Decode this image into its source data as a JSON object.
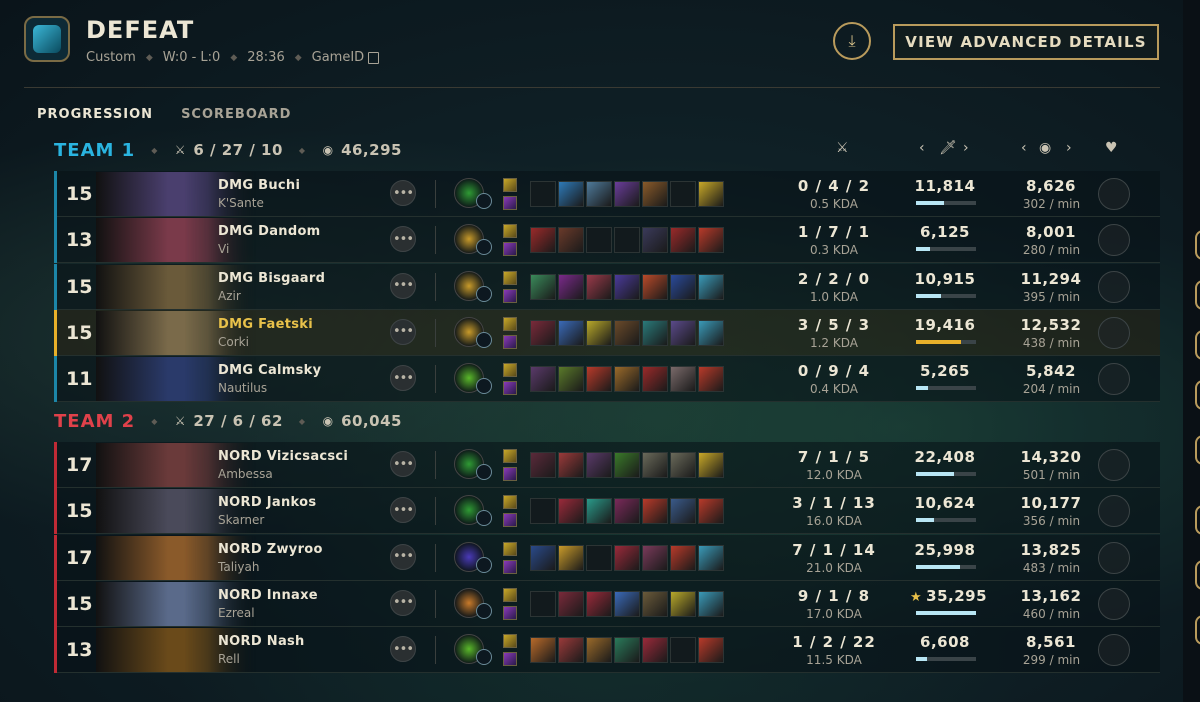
{
  "header": {
    "title": "DEFEAT",
    "mode": "Custom",
    "record": "W:0 - L:0",
    "duration": "28:36",
    "game_id_label": "GameID",
    "advanced_button": "VIEW ADVANCED DETAILS"
  },
  "tabs": [
    "PROGRESSION",
    "SCOREBOARD"
  ],
  "teams": [
    {
      "name": "TEAM 1",
      "kda": "6 / 27 / 10",
      "gold": "46,295",
      "color": "#2ab4e0",
      "players": [
        {
          "level": "15",
          "name": "DMG Buchi",
          "champion": "K'Sante",
          "kda": "0 / 4 / 2",
          "kda_ratio": "0.5 KDA",
          "damage": "11,814",
          "damage_fraction": 0.46,
          "gold": "8,626",
          "gpm": "302 / min",
          "portrait_color": "#4a3f6e",
          "rune_color": "#2f9a34",
          "items": [
            "",
            "#2e7ab8",
            "#4e7a9a",
            "#6a3d9a",
            "#8a5a2a",
            "",
            "#c8a828"
          ]
        },
        {
          "level": "13",
          "name": "DMG Dandom",
          "champion": "Vi",
          "kda": "1 / 7 / 1",
          "kda_ratio": "0.3 KDA",
          "damage": "6,125",
          "damage_fraction": 0.24,
          "gold": "8,001",
          "gpm": "280 / min",
          "portrait_color": "#7a3a4a",
          "rune_color": "#c89a2a",
          "items": [
            "#9a2a2a",
            "#6a3a2a",
            "",
            "",
            "#3a3a5a",
            "#9a2a2a",
            "#b83a2a"
          ]
        },
        {
          "level": "15",
          "name": "DMG Bisgaard",
          "champion": "Azir",
          "kda": "2 / 2 / 0",
          "kda_ratio": "1.0 KDA",
          "damage": "10,915",
          "damage_fraction": 0.42,
          "gold": "11,294",
          "gpm": "395 / min",
          "portrait_color": "#6a5a3a",
          "rune_color": "#c89a2a",
          "items": [
            "#3a8a5a",
            "#7a2a8a",
            "#9a3a4a",
            "#4a3a9a",
            "#b84a2a",
            "#2a4a9a",
            "#3a9ab8"
          ]
        },
        {
          "level": "15",
          "name": "DMG Faetski",
          "champion": "Corki",
          "kda": "3 / 5 / 3",
          "kda_ratio": "1.2 KDA",
          "damage": "19,416",
          "damage_fraction": 0.75,
          "gold": "12,532",
          "gpm": "438 / min",
          "portrait_color": "#7a6a4a",
          "rune_color": "#c89a2a",
          "items": [
            "#7a2a3a",
            "#3a6ab8",
            "#b8a82a",
            "#6a4a2a",
            "#2a7a7a",
            "#5a4a8a",
            "#3a9ab8"
          ]
        },
        {
          "level": "11",
          "name": "DMG Calmsky",
          "champion": "Nautilus",
          "kda": "0 / 9 / 4",
          "kda_ratio": "0.4 KDA",
          "damage": "5,265",
          "damage_fraction": 0.2,
          "gold": "5,842",
          "gpm": "204 / min",
          "portrait_color": "#2a3a6a",
          "rune_color": "#5ab82a",
          "items": [
            "#5a3a6a",
            "#5a7a2a",
            "#b83a2a",
            "#9a6a2a",
            "#9a2a2a",
            "#7a6a6a",
            "#b83a2a"
          ]
        }
      ]
    },
    {
      "name": "TEAM 2",
      "kda": "27 / 6 / 62",
      "gold": "60,045",
      "color": "#e0414a",
      "players": [
        {
          "level": "17",
          "name": "NORD Vizicsacsci",
          "champion": "Ambessa",
          "kda": "7 / 1 / 5",
          "kda_ratio": "12.0 KDA",
          "damage": "22,408",
          "damage_fraction": 0.64,
          "gold": "14,320",
          "gpm": "501 / min",
          "portrait_color": "#6a3a3a",
          "rune_color": "#2f9a34",
          "items": [
            "#5a2a3a",
            "#9a3a3a",
            "#5a3a6a",
            "#3a7a2a",
            "#6a6a5a",
            "#6a6a5a",
            "#c8a828"
          ]
        },
        {
          "level": "15",
          "name": "NORD Jankos",
          "champion": "Skarner",
          "kda": "3 / 1 / 13",
          "kda_ratio": "16.0 KDA",
          "damage": "10,624",
          "damage_fraction": 0.3,
          "gold": "10,177",
          "gpm": "356 / min",
          "portrait_color": "#4a4a5a",
          "rune_color": "#2f9a34",
          "items": [
            "",
            "#9a2a3a",
            "#2a9a8a",
            "#7a2a5a",
            "#b83a2a",
            "#3a5a8a",
            "#b83a2a"
          ]
        },
        {
          "level": "17",
          "name": "NORD Zwyroo",
          "champion": "Taliyah",
          "kda": "7 / 1 / 14",
          "kda_ratio": "21.0 KDA",
          "damage": "25,998",
          "damage_fraction": 0.74,
          "gold": "13,825",
          "gpm": "483 / min",
          "portrait_color": "#8a5a2a",
          "rune_color": "#4a3ab8",
          "items": [
            "#2a4a8a",
            "#c89a2a",
            "",
            "#9a2a3a",
            "#7a3a5a",
            "#b83a2a",
            "#3a9ab8"
          ]
        },
        {
          "level": "15",
          "name": "NORD Innaxe",
          "champion": "Ezreal",
          "kda": "9 / 1 / 8",
          "kda_ratio": "17.0 KDA",
          "damage": "35,295",
          "damage_fraction": 1.0,
          "gold": "13,162",
          "gpm": "460 / min",
          "starred": true,
          "portrait_color": "#5a6a8a",
          "rune_color": "#c87a2a",
          "items": [
            "",
            "#7a2a3a",
            "#9a2a3a",
            "#3a6ab8",
            "#6a5a3a",
            "#b8a82a",
            "#3a9ab8"
          ]
        },
        {
          "level": "13",
          "name": "NORD Nash",
          "champion": "Rell",
          "kda": "1 / 2 / 22",
          "kda_ratio": "11.5 KDA",
          "damage": "6,608",
          "damage_fraction": 0.19,
          "gold": "8,561",
          "gpm": "299 / min",
          "portrait_color": "#6a4a1a",
          "rune_color": "#5ab82a",
          "items": [
            "#b86a2a",
            "#9a3a3a",
            "#9a6a2a",
            "#2a7a5a",
            "#9a2a3a",
            "",
            "#b83a2a"
          ]
        }
      ]
    }
  ],
  "icons": {
    "download": "download-icon",
    "copy": "copy-icon",
    "kda": "crossed-swords-icon",
    "gold": "gold-coins-icon",
    "damage": "sword-icon",
    "heart": "heart-icon",
    "more": "ellipsis-icon"
  }
}
